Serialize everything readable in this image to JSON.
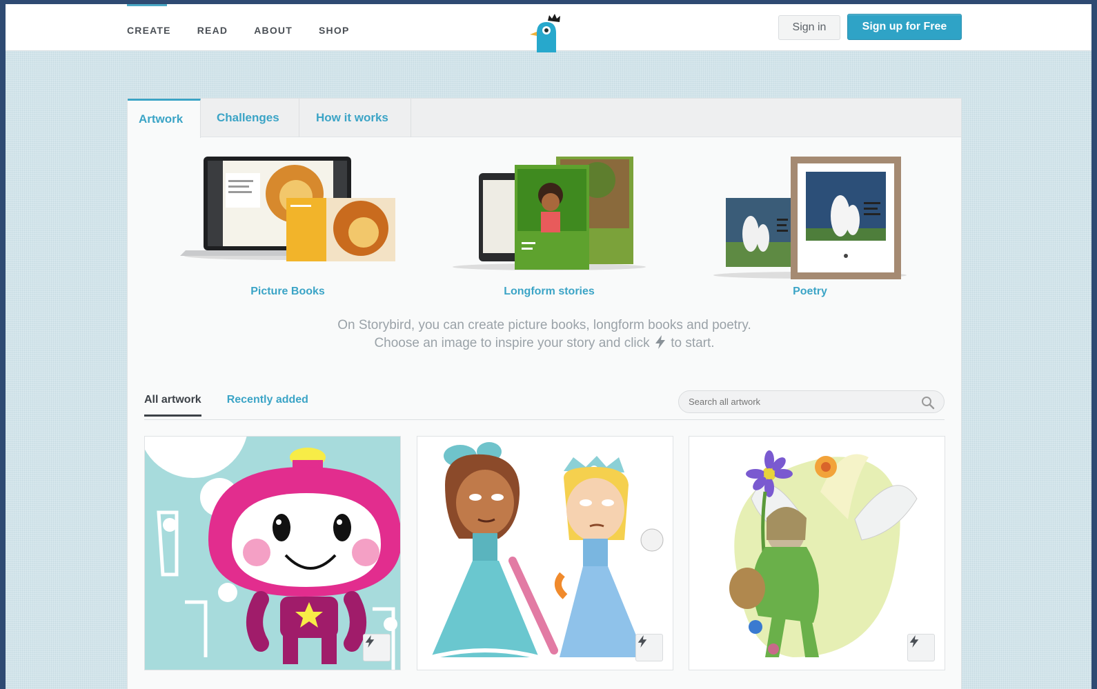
{
  "nav": {
    "items": [
      "CREATE",
      "READ",
      "ABOUT",
      "SHOP"
    ],
    "signin_label": "Sign in",
    "signup_label": "Sign up for Free",
    "logo_icon": "storybird-logo-icon"
  },
  "tabs": [
    "Artwork",
    "Challenges",
    "How it works"
  ],
  "features": [
    {
      "label": "Picture Books",
      "icon": "laptop-picture-book-image"
    },
    {
      "label": "Longform stories",
      "icon": "ebook-longform-image"
    },
    {
      "label": "Poetry",
      "icon": "framed-poem-image"
    }
  ],
  "intro": {
    "line1": "On Storybird, you can create picture books, longform books and poetry.",
    "line2_before": "Choose an image to inspire your story and click",
    "line2_after": "to start."
  },
  "gallery": {
    "subtabs": [
      "All artwork",
      "Recently added"
    ],
    "search_placeholder": "Search all artwork",
    "cards": [
      {
        "name": "pink-robot-artwork"
      },
      {
        "name": "two-princesses-artwork"
      },
      {
        "name": "fairy-flowers-artwork"
      }
    ]
  },
  "colors": {
    "accent": "#3ba4c6",
    "signup": "#2fa3c6"
  }
}
